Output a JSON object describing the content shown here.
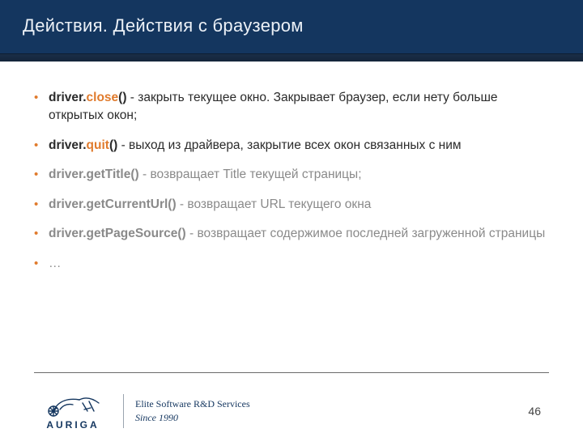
{
  "header": {
    "title": "Действия. Действия с браузером"
  },
  "bullets": [
    {
      "muted": false,
      "parts": [
        {
          "t": "driver.",
          "cls": "code-dark"
        },
        {
          "t": "close",
          "cls": "code-orange"
        },
        {
          "t": "()",
          "cls": "code-paren"
        },
        {
          "t": " - закрыть текущее окно. Закрывает браузер, если нету больше открытых окон;",
          "cls": "desc-dark"
        }
      ]
    },
    {
      "muted": false,
      "parts": [
        {
          "t": "driver.",
          "cls": "code-dark"
        },
        {
          "t": "quit",
          "cls": "code-orange"
        },
        {
          "t": "()",
          "cls": "code-paren"
        },
        {
          "t": " - выход из драйвера, закрытие всех окон связанных с ним",
          "cls": "desc-dark"
        }
      ]
    },
    {
      "muted": true,
      "parts": [
        {
          "t": "driver.getTitle()",
          "cls": "code-dark"
        },
        {
          "t": " - возвращает Title текущей страницы;",
          "cls": "desc-dark"
        }
      ]
    },
    {
      "muted": true,
      "parts": [
        {
          "t": "driver.getCurrentUrl()",
          "cls": "code-dark"
        },
        {
          "t": " - возвращает URL текущего окна",
          "cls": "desc-dark"
        }
      ]
    },
    {
      "muted": true,
      "parts": [
        {
          "t": "driver.getPageSource()",
          "cls": "code-dark"
        },
        {
          "t": " - возвращает содержимое последней загруженной страницы",
          "cls": "desc-dark"
        }
      ]
    },
    {
      "muted": true,
      "parts": [
        {
          "t": "…",
          "cls": "desc-dark"
        }
      ]
    }
  ],
  "footer": {
    "logo_name": "AURIGA",
    "tagline": "Elite Software R&D Services",
    "since": "Since 1990",
    "page": "46"
  }
}
